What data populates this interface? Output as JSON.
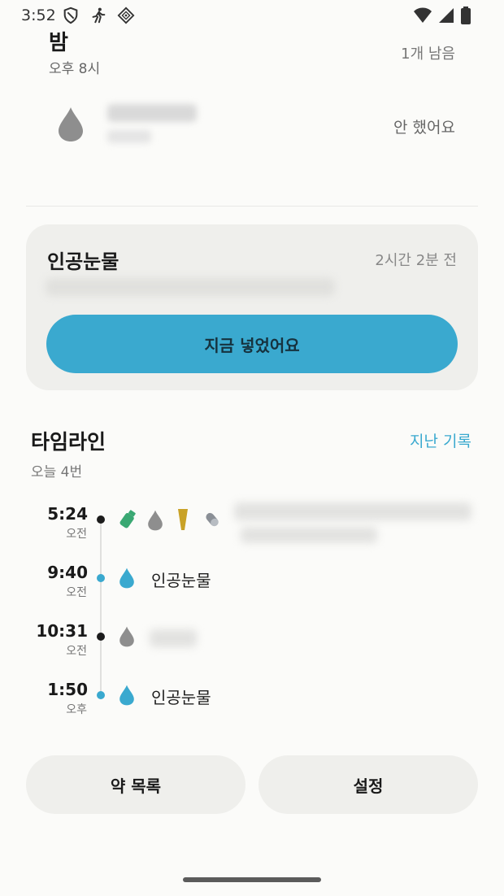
{
  "status_bar": {
    "time": "3:52",
    "left_icons": [
      "shield-icon",
      "walking-icon",
      "app-grid-icon"
    ],
    "right_icons": [
      "wifi-icon",
      "signal-icon",
      "battery-icon"
    ]
  },
  "night_section": {
    "title": "밤",
    "time": "오후 8시",
    "remaining": "1개 남음",
    "item_status": "안 했어요",
    "item_icon": "drop-icon"
  },
  "current_card": {
    "title": "인공눈물",
    "elapsed": "2시간 2분 전",
    "action_label": "지금 넣었어요"
  },
  "timeline": {
    "title": "타임라인",
    "history_link": "지난 기록",
    "count": "오늘 4번",
    "entries": [
      {
        "time": "5:24",
        "ampm": "오전",
        "label": ""
      },
      {
        "time": "9:40",
        "ampm": "오전",
        "label": "인공눈물"
      },
      {
        "time": "10:31",
        "ampm": "오전",
        "label": ""
      },
      {
        "time": "1:50",
        "ampm": "오후",
        "label": "인공눈물"
      }
    ]
  },
  "bottom_buttons": {
    "list_label": "약 목록",
    "settings_label": "설정"
  },
  "colors": {
    "accent": "#3aa9cf",
    "background": "#fbfbf9",
    "card": "#efefec",
    "drop_gray": "#8e8e8e",
    "drop_blue": "#3aa9cf",
    "pill_green": "#3aa873",
    "pill_yellow": "#c9a227"
  }
}
